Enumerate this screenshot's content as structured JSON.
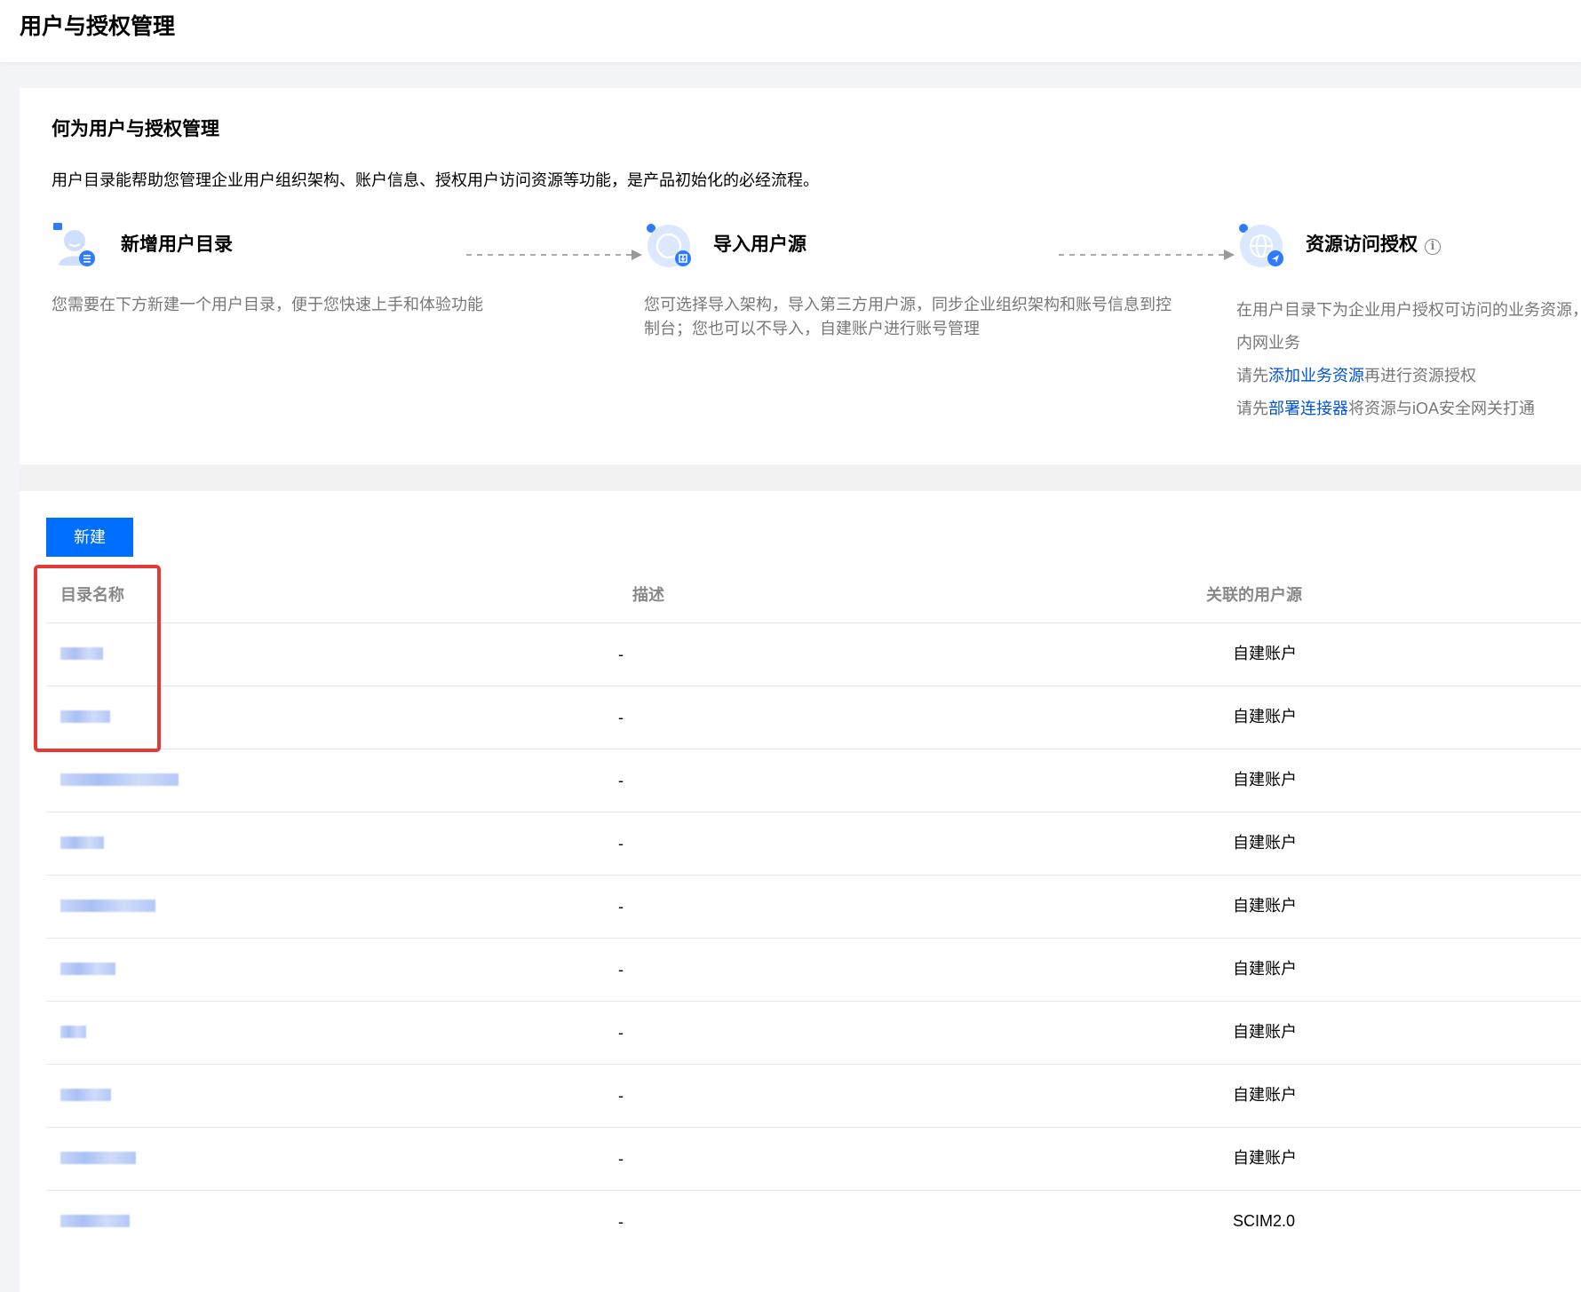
{
  "page": {
    "title": "用户与授权管理"
  },
  "intro": {
    "heading": "何为用户与授权管理",
    "description": "用户目录能帮助您管理企业用户组织架构、账户信息、授权用户访问资源等功能，是产品初始化的必经流程。",
    "steps": [
      {
        "title": "新增用户目录",
        "icon": "user-directory-icon",
        "text": "您需要在下方新建一个用户目录，便于您快速上手和体验功能"
      },
      {
        "title": "导入用户源",
        "icon": "import-source-icon",
        "text": "您可选择导入架构，导入第三方用户源，同步企业组织架构和账号信息到控制台；您也可以不导入，自建账户进行账号管理"
      },
      {
        "title": "资源访问授权",
        "icon": "globe-access-icon",
        "line1": "在用户目录下为企业用户授权可访问的业务资源，",
        "line2": "内网业务",
        "line3_prefix": "请先",
        "line3_link": "添加业务资源",
        "line3_suffix": "再进行资源授权",
        "line4_prefix": "请先",
        "line4_link": "部署连接器",
        "line4_suffix": "将资源与iOA安全网关打通"
      }
    ]
  },
  "list": {
    "new_button": "新建",
    "columns": [
      "目录名称",
      "描述",
      "关联的用户源"
    ],
    "rows": [
      {
        "description": "-",
        "source": "自建账户"
      },
      {
        "description": "-",
        "source": "自建账户"
      },
      {
        "description": "-",
        "source": "自建账户"
      },
      {
        "description": "-",
        "source": "自建账户"
      },
      {
        "description": "-",
        "source": "自建账户"
      },
      {
        "description": "-",
        "source": "自建账户"
      },
      {
        "description": "-",
        "source": "自建账户"
      },
      {
        "description": "-",
        "source": "自建账户"
      },
      {
        "description": "-",
        "source": "自建账户"
      },
      {
        "description": "-",
        "source": "SCIM2.0"
      }
    ]
  },
  "colors": {
    "primary": "#006eff",
    "link": "#0052d9",
    "highlight": "#e53935"
  }
}
